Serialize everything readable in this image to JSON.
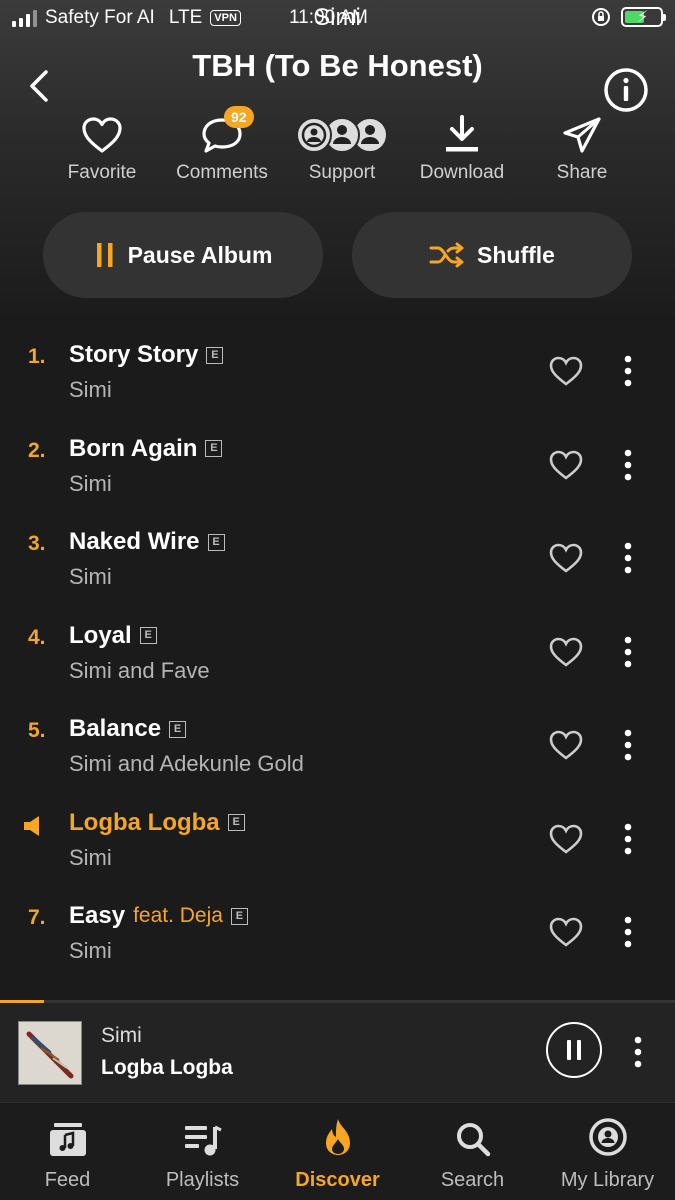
{
  "status_bar": {
    "carrier": "Safety For AI",
    "network": "LTE",
    "vpn": "VPN",
    "time": "11:00 AM"
  },
  "artist_overlay": "Simi",
  "header": {
    "title": "TBH (To Be Honest)"
  },
  "actions": {
    "favorite": "Favorite",
    "comments": "Comments",
    "comments_count": "92",
    "support": "Support",
    "download": "Download",
    "share": "Share"
  },
  "buttons": {
    "pause_album": "Pause Album",
    "shuffle": "Shuffle"
  },
  "explicit_label": "E",
  "tracks": [
    {
      "number": "1.",
      "title": "Story Story",
      "feat": "",
      "artist": "Simi",
      "playing": false
    },
    {
      "number": "2.",
      "title": "Born Again",
      "feat": "",
      "artist": "Simi",
      "playing": false
    },
    {
      "number": "3.",
      "title": "Naked Wire",
      "feat": "",
      "artist": "Simi",
      "playing": false
    },
    {
      "number": "4.",
      "title": "Loyal",
      "feat": "",
      "artist": "Simi and Fave",
      "playing": false
    },
    {
      "number": "5.",
      "title": "Balance",
      "feat": "",
      "artist": "Simi and Adekunle Gold",
      "playing": false
    },
    {
      "number": "",
      "title": "Logba Logba",
      "feat": "",
      "artist": "Simi",
      "playing": true
    },
    {
      "number": "7.",
      "title": "Easy",
      "feat": "feat. Deja",
      "artist": "Simi",
      "playing": false
    }
  ],
  "mini_player": {
    "artist": "Simi",
    "song": "Logba Logba",
    "progress": 0.065
  },
  "tabs": [
    {
      "label": "Feed",
      "icon": "feed-icon",
      "active": false
    },
    {
      "label": "Playlists",
      "icon": "playlists-icon",
      "active": false
    },
    {
      "label": "Discover",
      "icon": "flame-icon",
      "active": true
    },
    {
      "label": "Search",
      "icon": "search-icon",
      "active": false
    },
    {
      "label": "My Library",
      "icon": "library-icon",
      "active": false
    }
  ],
  "colors": {
    "accent": "#f5a623",
    "background": "#1b1b1b",
    "button_bg": "#333333"
  }
}
